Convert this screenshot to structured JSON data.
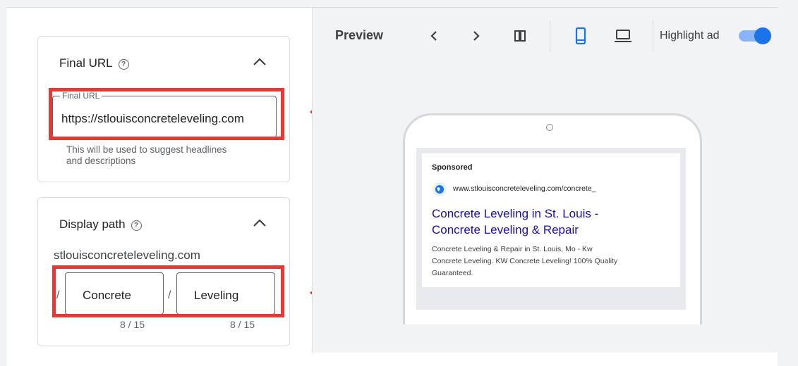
{
  "final_url_card": {
    "title": "Final URL",
    "help_icon": "help-circle-icon",
    "collapse_icon": "chevron-up-icon",
    "field_label": "Final URL",
    "field_value": "https://stlouisconcreteleveling.com",
    "helper_line1": "This will be used to suggest headlines",
    "helper_line2": "and descriptions"
  },
  "display_path_card": {
    "title": "Display path",
    "help_icon": "help-circle-icon",
    "collapse_icon": "chevron-up-icon",
    "domain": "stlouisconcreteleveling.com",
    "separator": "/",
    "path1": "Concrete",
    "path2": "Leveling",
    "path1_counter": "8 / 15",
    "path2_counter": "8 / 15"
  },
  "preview": {
    "label": "Preview",
    "highlight_label": "Highlight ad",
    "highlight_on": true,
    "icons": [
      "chevron-left-icon",
      "chevron-right-icon",
      "columns-icon",
      "mobile-icon",
      "laptop-icon"
    ]
  },
  "ad": {
    "sponsored": "Sponsored",
    "favicon": "globe-icon",
    "display_url": "www.stlouisconcreteleveling.com/concrete_",
    "headline_line1": "Concrete Leveling in St. Louis -",
    "headline_line2": "Concrete Leveling & Repair",
    "desc_line1": "Concrete Leveling & Repair in St. Louis, Mo - Kw",
    "desc_line2": "Concrete Leveling. KW Concrete Leveling! 100% Quality",
    "desc_line3": "Guaranteed."
  },
  "colors": {
    "highlight": "#e53935",
    "accent": "#1a73e8",
    "link": "#1a0dab"
  }
}
